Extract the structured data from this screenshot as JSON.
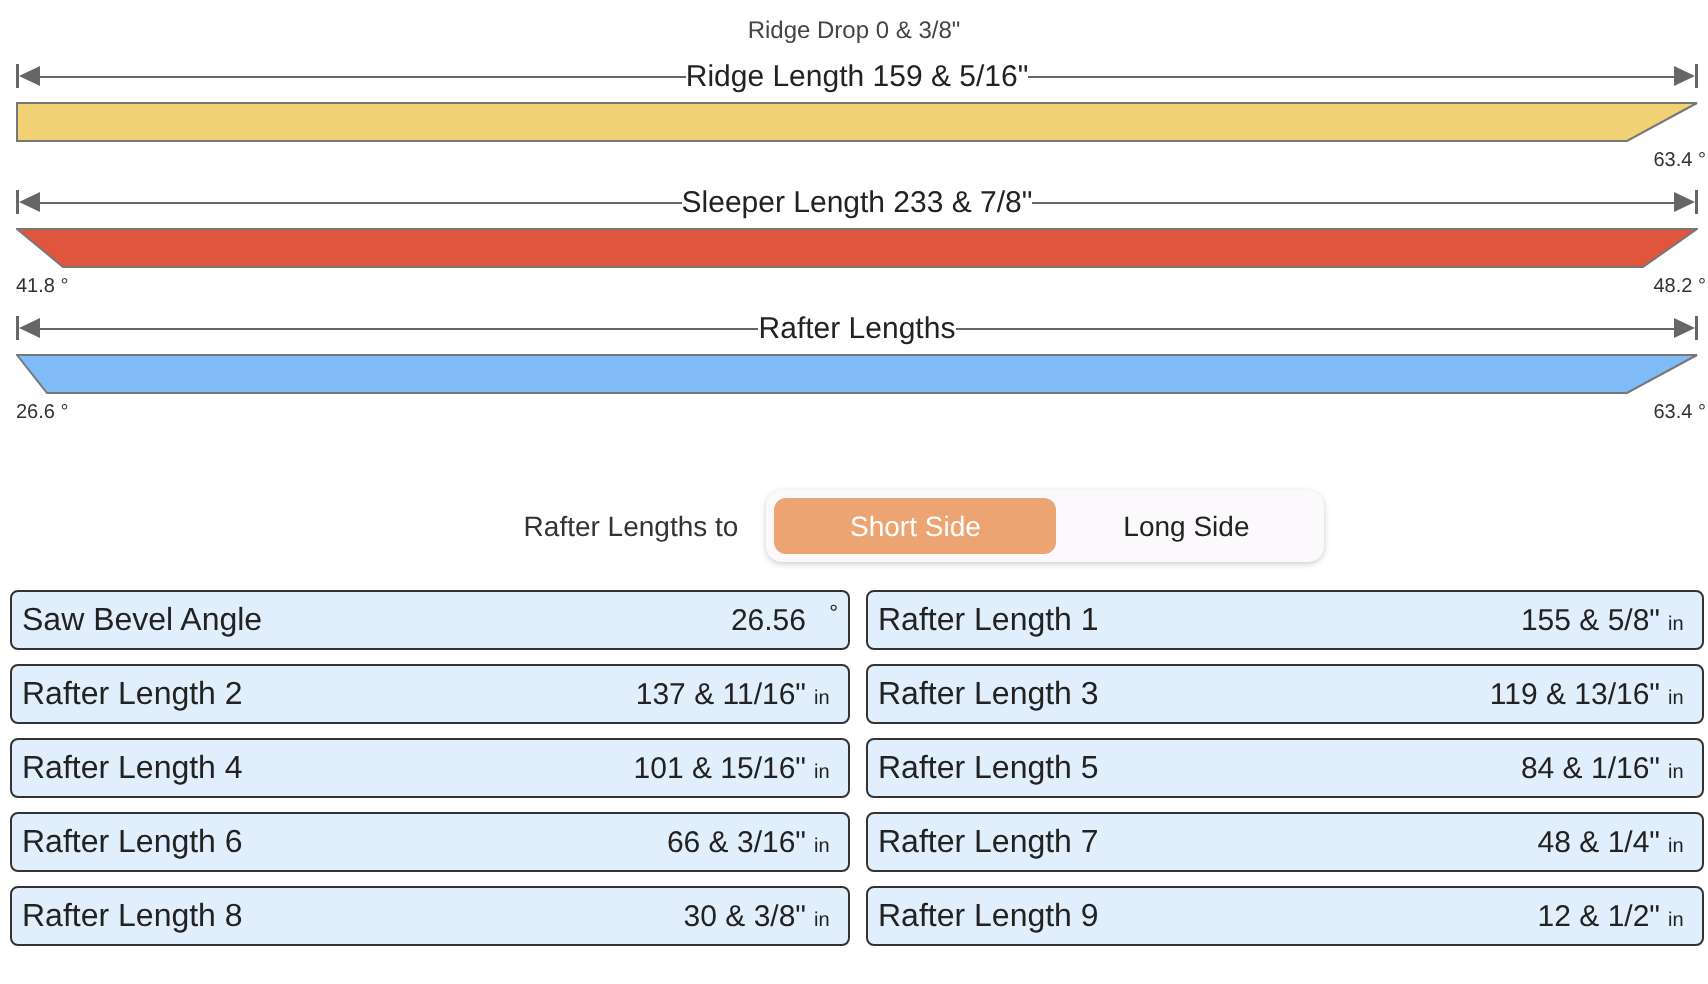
{
  "ridge_drop": "Ridge Drop 0 & 3/8\"",
  "boards": [
    {
      "label": "Ridge Length 159 & 5/16\"",
      "color": "#f0d275",
      "right_angle": "63.4 °"
    },
    {
      "label": "Sleeper Length 233 & 7/8\"",
      "color": "#e0553e",
      "left_angle": "41.8 °",
      "right_angle": "48.2 °"
    },
    {
      "label": "Rafter Lengths",
      "color": "#80baf7",
      "left_angle": "26.6 °",
      "right_angle": "63.4 °"
    }
  ],
  "toggle": {
    "label": "Rafter Lengths to",
    "options": [
      {
        "label": "Short Side",
        "selected": true
      },
      {
        "label": "Long Side",
        "selected": false
      }
    ]
  },
  "results": [
    {
      "label": "Saw Bevel Angle",
      "value": "26.56",
      "unit": "°"
    },
    {
      "label": "Rafter Length 1",
      "value": "155 & 5/8\"",
      "unit": "in"
    },
    {
      "label": "Rafter Length 2",
      "value": "137 & 11/16\"",
      "unit": "in"
    },
    {
      "label": "Rafter Length 3",
      "value": "119 & 13/16\"",
      "unit": "in"
    },
    {
      "label": "Rafter Length 4",
      "value": "101 & 15/16\"",
      "unit": "in"
    },
    {
      "label": "Rafter Length 5",
      "value": "84 & 1/16\"",
      "unit": "in"
    },
    {
      "label": "Rafter Length 6",
      "value": "66 & 3/16\"",
      "unit": "in"
    },
    {
      "label": "Rafter Length 7",
      "value": "48 & 1/4\"",
      "unit": "in"
    },
    {
      "label": "Rafter Length 8",
      "value": "30 & 3/8\"",
      "unit": "in"
    },
    {
      "label": "Rafter Length 9",
      "value": "12 & 1/2\"",
      "unit": "in"
    }
  ]
}
